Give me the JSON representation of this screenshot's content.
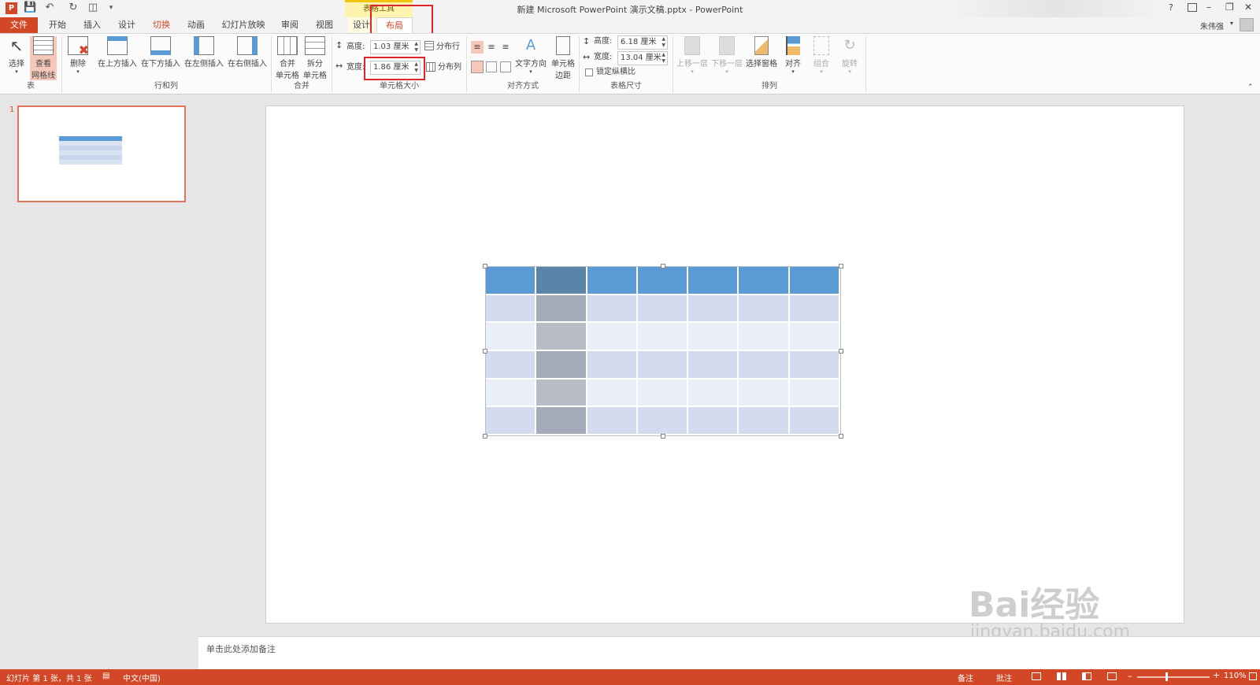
{
  "window": {
    "title": "新建 Microsoft PowerPoint 演示文稿.pptx - PowerPoint",
    "context_tab_group": "表格工具",
    "user": "朱伟强",
    "help": "?",
    "win_controls": [
      "–",
      "❐",
      "✕"
    ]
  },
  "tabs": [
    {
      "label": "文件"
    },
    {
      "label": "开始"
    },
    {
      "label": "插入"
    },
    {
      "label": "设计"
    },
    {
      "label": "切换"
    },
    {
      "label": "动画"
    },
    {
      "label": "幻灯片放映"
    },
    {
      "label": "审阅"
    },
    {
      "label": "视图"
    },
    {
      "label": "设计"
    },
    {
      "label": "布局"
    }
  ],
  "ribbon": {
    "table_group": {
      "label": "表",
      "select": "选择",
      "gridlines_1": "查看",
      "gridlines_2": "网格线"
    },
    "rows_cols": {
      "label": "行和列",
      "delete": "删除",
      "insert_above": "在上方插入",
      "insert_below": "在下方插入",
      "insert_left": "在左侧插入",
      "insert_right": "在右侧插入"
    },
    "merge": {
      "label": "合并",
      "merge_1": "合并",
      "merge_2": "单元格",
      "split_1": "拆分",
      "split_2": "单元格"
    },
    "cell_size": {
      "label": "单元格大小",
      "height_label": "高度:",
      "height_value": "1.03 厘米",
      "width_label": "宽度:",
      "width_value": "1.86 厘米",
      "distribute_rows": "分布行",
      "distribute_cols": "分布列"
    },
    "alignment": {
      "label": "对齐方式",
      "text_direction": "文字方向",
      "cell_margin_1": "单元格",
      "cell_margin_2": "边距"
    },
    "table_size": {
      "label": "表格尺寸",
      "height_label": "高度:",
      "height_value": "6.18 厘米",
      "width_label": "宽度:",
      "width_value": "13.04 厘米",
      "lock_ratio": "锁定纵横比"
    },
    "arrange": {
      "label": "排列",
      "bring_forward": "上移一层",
      "send_backward": "下移一层",
      "selection_pane": "选择窗格",
      "align": "对齐",
      "group": "组合",
      "rotate": "旋转"
    }
  },
  "slide_panel": {
    "slide_number": "1"
  },
  "notes_placeholder": "单击此处添加备注",
  "status": {
    "slide_info": "幻灯片 第 1 张，共 1 张",
    "language": "中文(中国)",
    "notes": "备注",
    "comments": "批注",
    "zoom": "110%"
  },
  "table": {
    "rows": 6,
    "cols": 7,
    "selected_col": 1
  },
  "colors": {
    "accent": "#d24726",
    "header": "#5b9bd5",
    "header_selected": "#5a84a8",
    "row_dark": "#d2dcee",
    "row_light": "#e9eef7",
    "sel_dark": "#a5abb8",
    "sel_light": "#b9bcc4"
  },
  "watermark": {
    "text": "Bai经验",
    "url": "jingyan.baidu.com"
  }
}
